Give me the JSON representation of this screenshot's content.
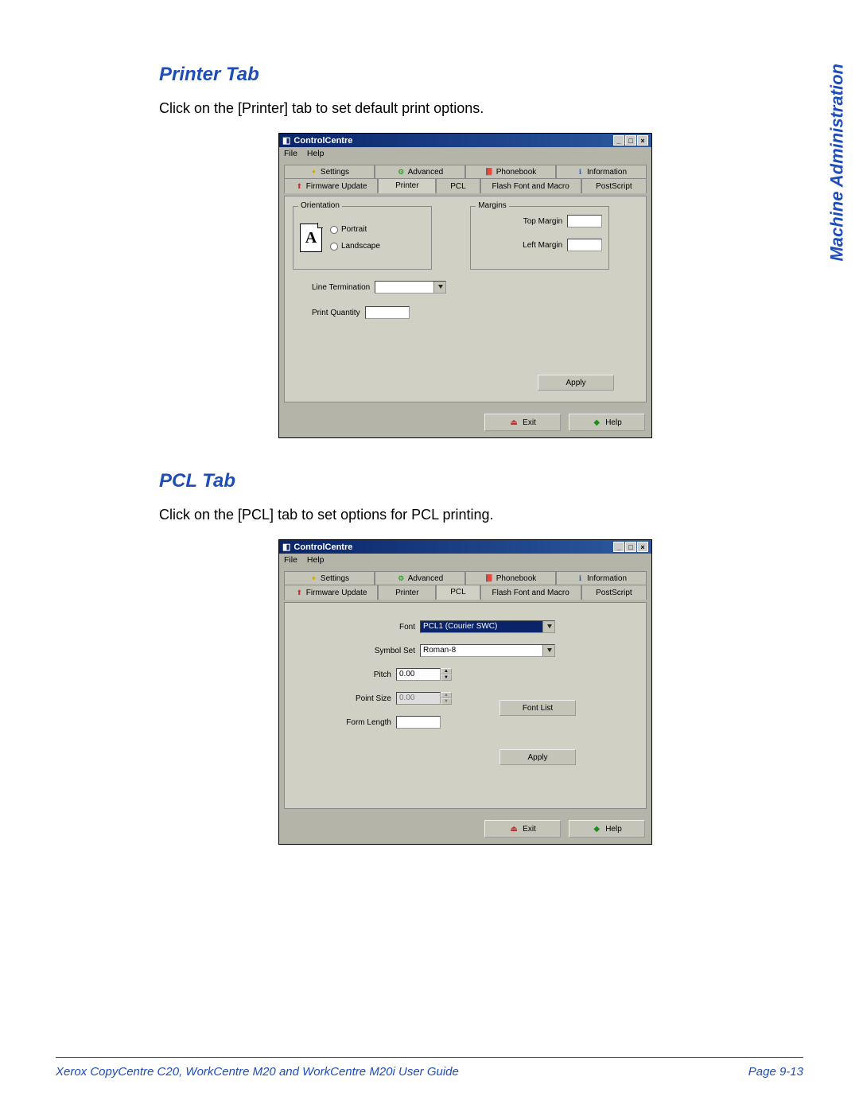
{
  "sidebar_label": "Machine Administration",
  "sections": [
    {
      "title": "Printer Tab",
      "desc": "Click on the [Printer] tab to set default print options."
    },
    {
      "title": "PCL Tab",
      "desc": "Click on the [PCL] tab to set options for PCL printing."
    }
  ],
  "cc": {
    "title": "ControlCentre",
    "menu": {
      "file": "File",
      "help": "Help"
    },
    "tabs_row1": {
      "settings": "Settings",
      "advanced": "Advanced",
      "phonebook": "Phonebook",
      "information": "Information"
    },
    "tabs_row2": {
      "firmware": "Firmware Update",
      "printer": "Printer",
      "pcl": "PCL",
      "flash": "Flash Font and Macro",
      "postscript": "PostScript"
    },
    "printer_panel": {
      "orientation_legend": "Orientation",
      "portrait": "Portrait",
      "landscape": "Landscape",
      "margins_legend": "Margins",
      "top_margin": "Top Margin",
      "left_margin": "Left Margin",
      "line_termination": "Line Termination",
      "print_quantity": "Print Quantity"
    },
    "pcl_panel": {
      "font_label": "Font",
      "font_value": "PCL1 (Courier SWC)",
      "symbol_label": "Symbol Set",
      "symbol_value": "Roman-8",
      "pitch_label": "Pitch",
      "pitch_value": "0.00",
      "point_label": "Point Size",
      "point_value": "0.00",
      "form_label": "Form Length",
      "fontlist_btn": "Font List"
    },
    "buttons": {
      "apply": "Apply",
      "exit": "Exit",
      "help": "Help"
    }
  },
  "footer": {
    "left": "Xerox CopyCentre C20, WorkCentre M20 and WorkCentre M20i User Guide",
    "right": "Page 9-13"
  }
}
